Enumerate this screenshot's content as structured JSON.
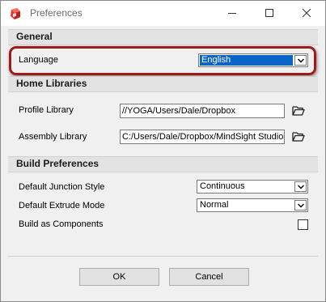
{
  "window": {
    "title": "Preferences"
  },
  "sections": {
    "general": "General",
    "home_libraries": "Home Libraries",
    "build_preferences": "Build Preferences"
  },
  "general": {
    "language_label": "Language",
    "language_value": "English"
  },
  "home_libraries": {
    "profile_label": "Profile Library",
    "profile_value": "//YOGA/Users/Dale/Dropbox",
    "assembly_label": "Assembly Library",
    "assembly_value": "C:/Users/Dale/Dropbox/MindSight Studios/"
  },
  "build": {
    "junction_label": "Default Junction Style",
    "junction_value": "Continuous",
    "extrude_label": "Default Extrude Mode",
    "extrude_value": "Normal",
    "components_label": "Build as Components",
    "components_checked": false
  },
  "buttons": {
    "ok": "OK",
    "cancel": "Cancel"
  },
  "colors": {
    "highlight": "#a01a1a",
    "selection": "#0a64c8"
  }
}
